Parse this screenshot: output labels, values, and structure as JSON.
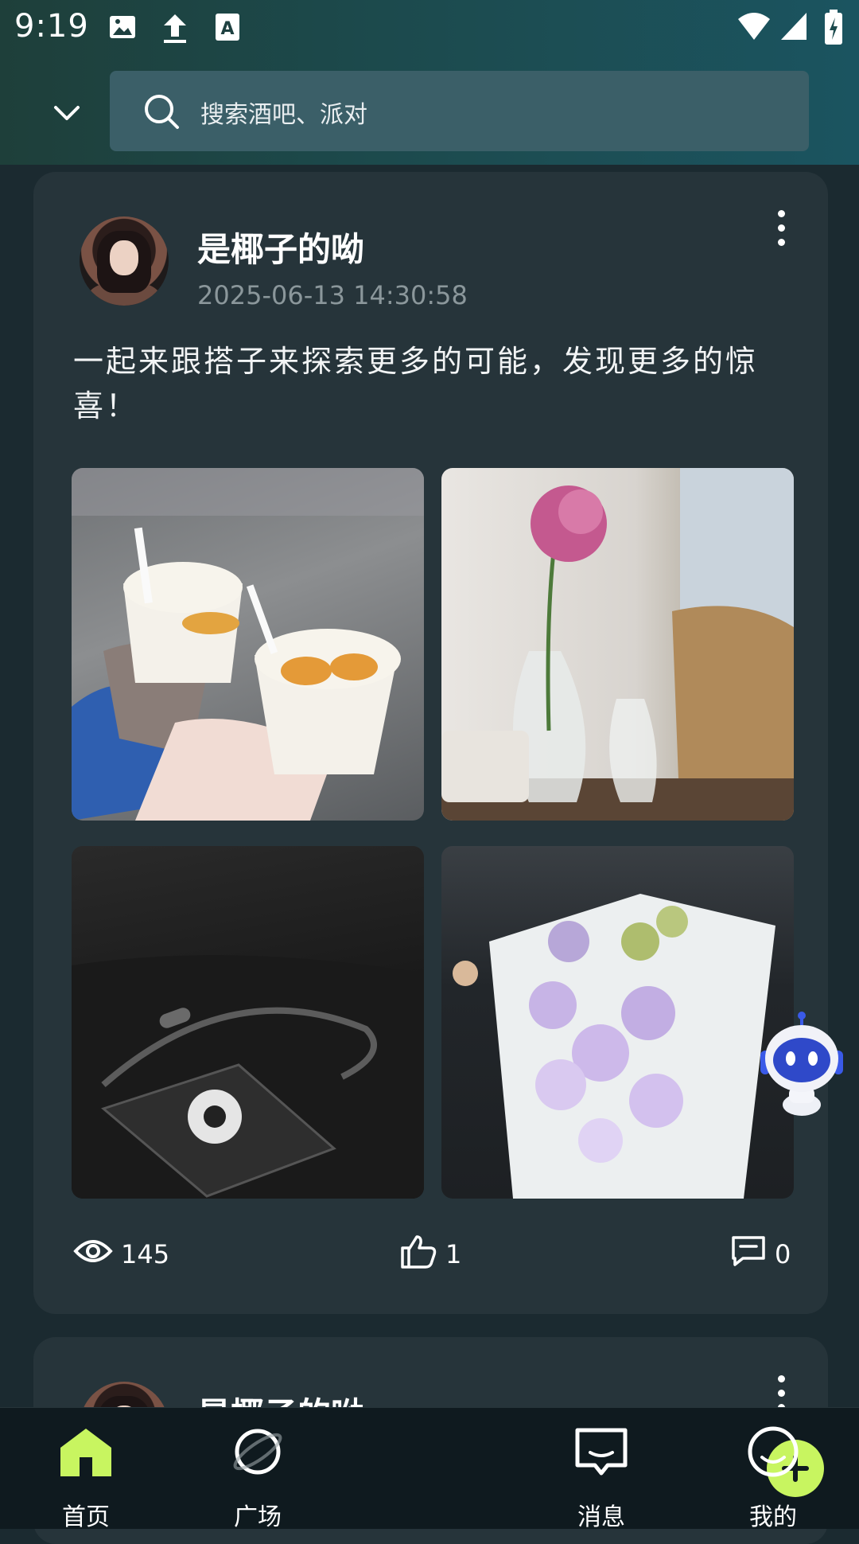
{
  "status_bar": {
    "time": "9:19"
  },
  "search": {
    "placeholder": "搜索酒吧、派对"
  },
  "posts": [
    {
      "author": "是椰子的呦",
      "timestamp": "2025-06-13 14:30:58",
      "text": "一起来跟搭子来探索更多的可能，发现更多的惊喜！",
      "views": "145",
      "likes": "1",
      "comments": "0",
      "photos": [
        "photo-drinks",
        "photo-flower-vase",
        "photo-earphones",
        "photo-bouquet"
      ]
    },
    {
      "author": "是椰子的呦"
    }
  ],
  "bottom_nav": {
    "home": "首页",
    "square": "广场",
    "messages": "消息",
    "mine": "我的"
  },
  "colors": {
    "accent": "#c8f560",
    "card": "#26343a",
    "background": "#1b2a30"
  }
}
